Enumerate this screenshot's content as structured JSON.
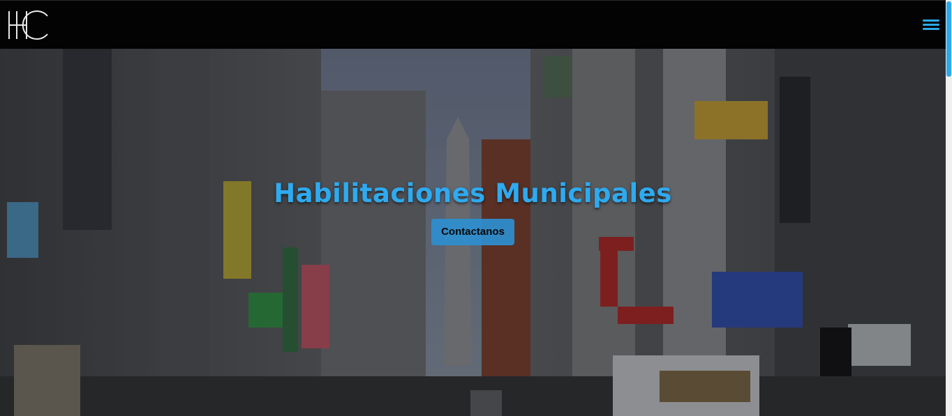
{
  "header": {
    "logo_text": "HC",
    "menu_icon": "hamburger-menu-icon"
  },
  "hero": {
    "title": "Habilitaciones Municipales",
    "cta_label": "Contactanos"
  },
  "colors": {
    "accent": "#2ea8e8",
    "header_bg": "#030303"
  }
}
